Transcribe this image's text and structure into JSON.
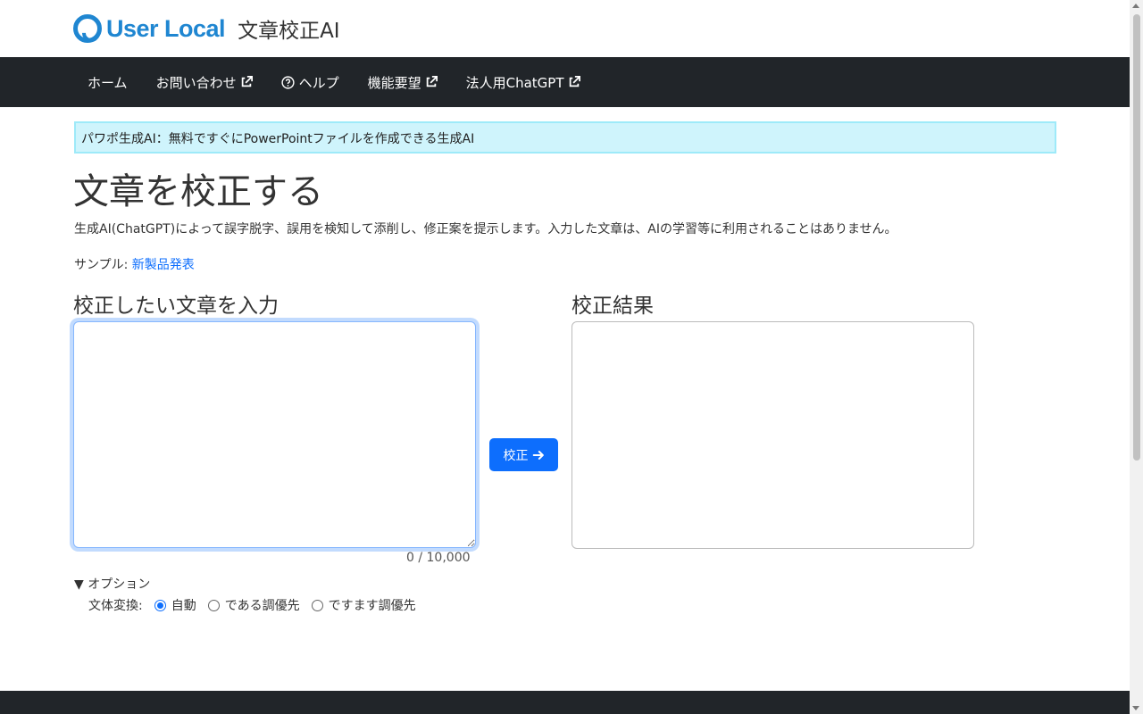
{
  "header": {
    "logo_text": "User Local",
    "app_title": "文章校正AI"
  },
  "nav": {
    "items": [
      {
        "label": "ホーム",
        "icon": null
      },
      {
        "label": "お問い合わせ",
        "icon": "external-link-icon"
      },
      {
        "label": "ヘルプ",
        "icon": "question-circle-icon"
      },
      {
        "label": "機能要望",
        "icon": "external-link-icon"
      },
      {
        "label": "法人用ChatGPT",
        "icon": "external-link-icon"
      }
    ]
  },
  "alert": {
    "text": "パワポ生成AI：無料ですぐにPowerPointファイルを作成できる生成AI"
  },
  "main": {
    "title": "文章を校正する",
    "lead": "生成AI(ChatGPT)によって誤字脱字、誤用を検知して添削し、修正案を提示します。入力した文章は、AIの学習等に利用されることはありません。",
    "sample_label": "サンプル: ",
    "sample_link": "新製品発表",
    "input_heading": "校正したい文章を入力",
    "result_heading": "校正結果",
    "input_value": "",
    "counter": "0 / 10,000",
    "proof_button": "校正"
  },
  "options": {
    "toggle_label": "▼ オプション",
    "style_label": "文体変換:",
    "choices": [
      {
        "label": "自動",
        "checked": true
      },
      {
        "label": "である調優先",
        "checked": false
      },
      {
        "label": "ですます調優先",
        "checked": false
      }
    ]
  },
  "colors": {
    "brand": "#1f86d1",
    "navbar": "#212529",
    "primary": "#0d6efd",
    "alert_bg": "#cff4fc"
  }
}
